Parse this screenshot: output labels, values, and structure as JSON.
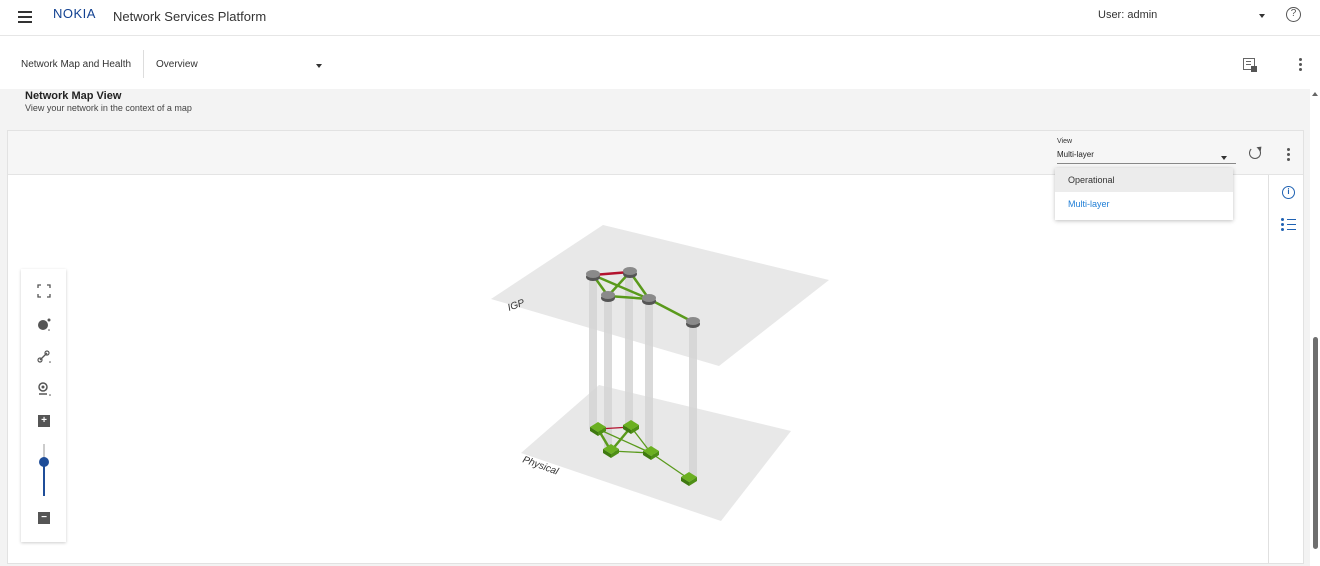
{
  "header": {
    "brand": "NOKIA",
    "app_title": "Network Services Platform",
    "user_label": "User: admin"
  },
  "subheader": {
    "breadcrumb": "Network Map and Health",
    "view_selector": "Overview"
  },
  "page": {
    "title": "Network Map View",
    "subtitle": "View your network in the context of a map"
  },
  "panel": {
    "view_label": "View",
    "view_value": "Multi-layer",
    "view_options": [
      "Operational",
      "Multi-layer"
    ]
  },
  "map": {
    "layers": [
      "IGP",
      "Physical"
    ],
    "link_colors": {
      "up": "#5a9a1c",
      "down": "#b3122e"
    },
    "node_color_router": "#7a7a7a",
    "node_color_physical": "#4e8f16"
  },
  "zoom": {
    "level_fraction": 0.65
  },
  "colors": {
    "accent": "#1f7ed6",
    "brand": "#124191"
  }
}
